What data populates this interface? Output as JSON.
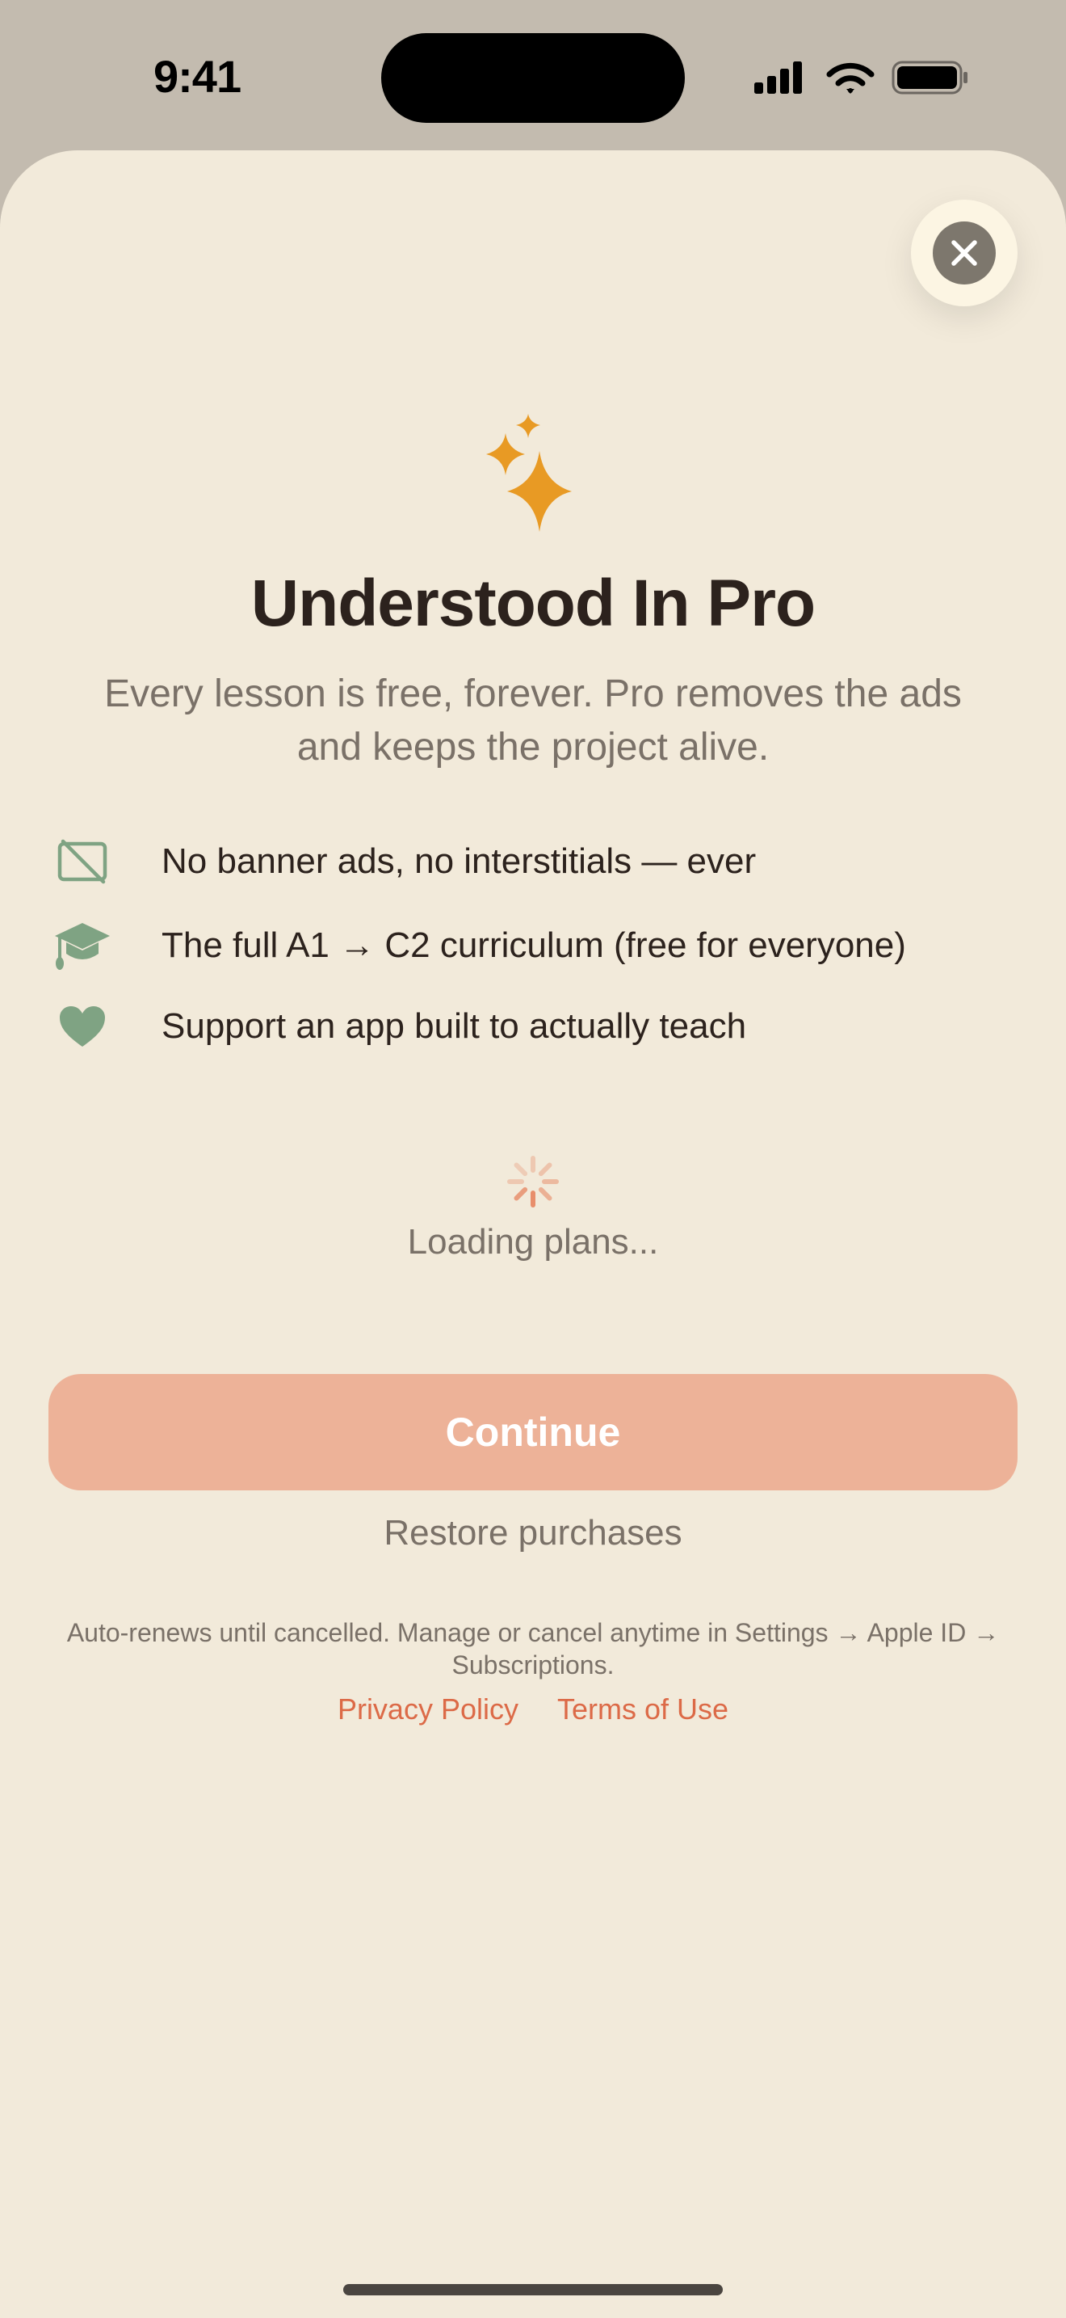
{
  "status_bar": {
    "time": "9:41"
  },
  "paywall": {
    "title": "Understood In Pro",
    "subtitle": "Every lesson is free, forever. Pro removes the ads and keeps the project alive.",
    "features": [
      {
        "icon": "no-ads-icon",
        "text": "No banner ads, no interstitials — ever"
      },
      {
        "icon": "graduation-cap-icon",
        "text": "The full A1 → C2 curriculum (free for everyone)"
      },
      {
        "icon": "heart-icon",
        "text": "Support an app built to actually teach"
      }
    ],
    "loading_text": "Loading plans...",
    "continue_label": "Continue",
    "restore_label": "Restore purchases",
    "disclaimer": "Auto-renews until cancelled. Manage or cancel anytime in Settings → Apple ID → Subscriptions.",
    "privacy_label": "Privacy Policy",
    "terms_label": "Terms of Use"
  },
  "colors": {
    "background": "#f2eada",
    "accent": "#dc6a47",
    "continue_disabled": "#edb298",
    "feature_icon": "#7fa383",
    "sparkle": "#e89a24"
  }
}
